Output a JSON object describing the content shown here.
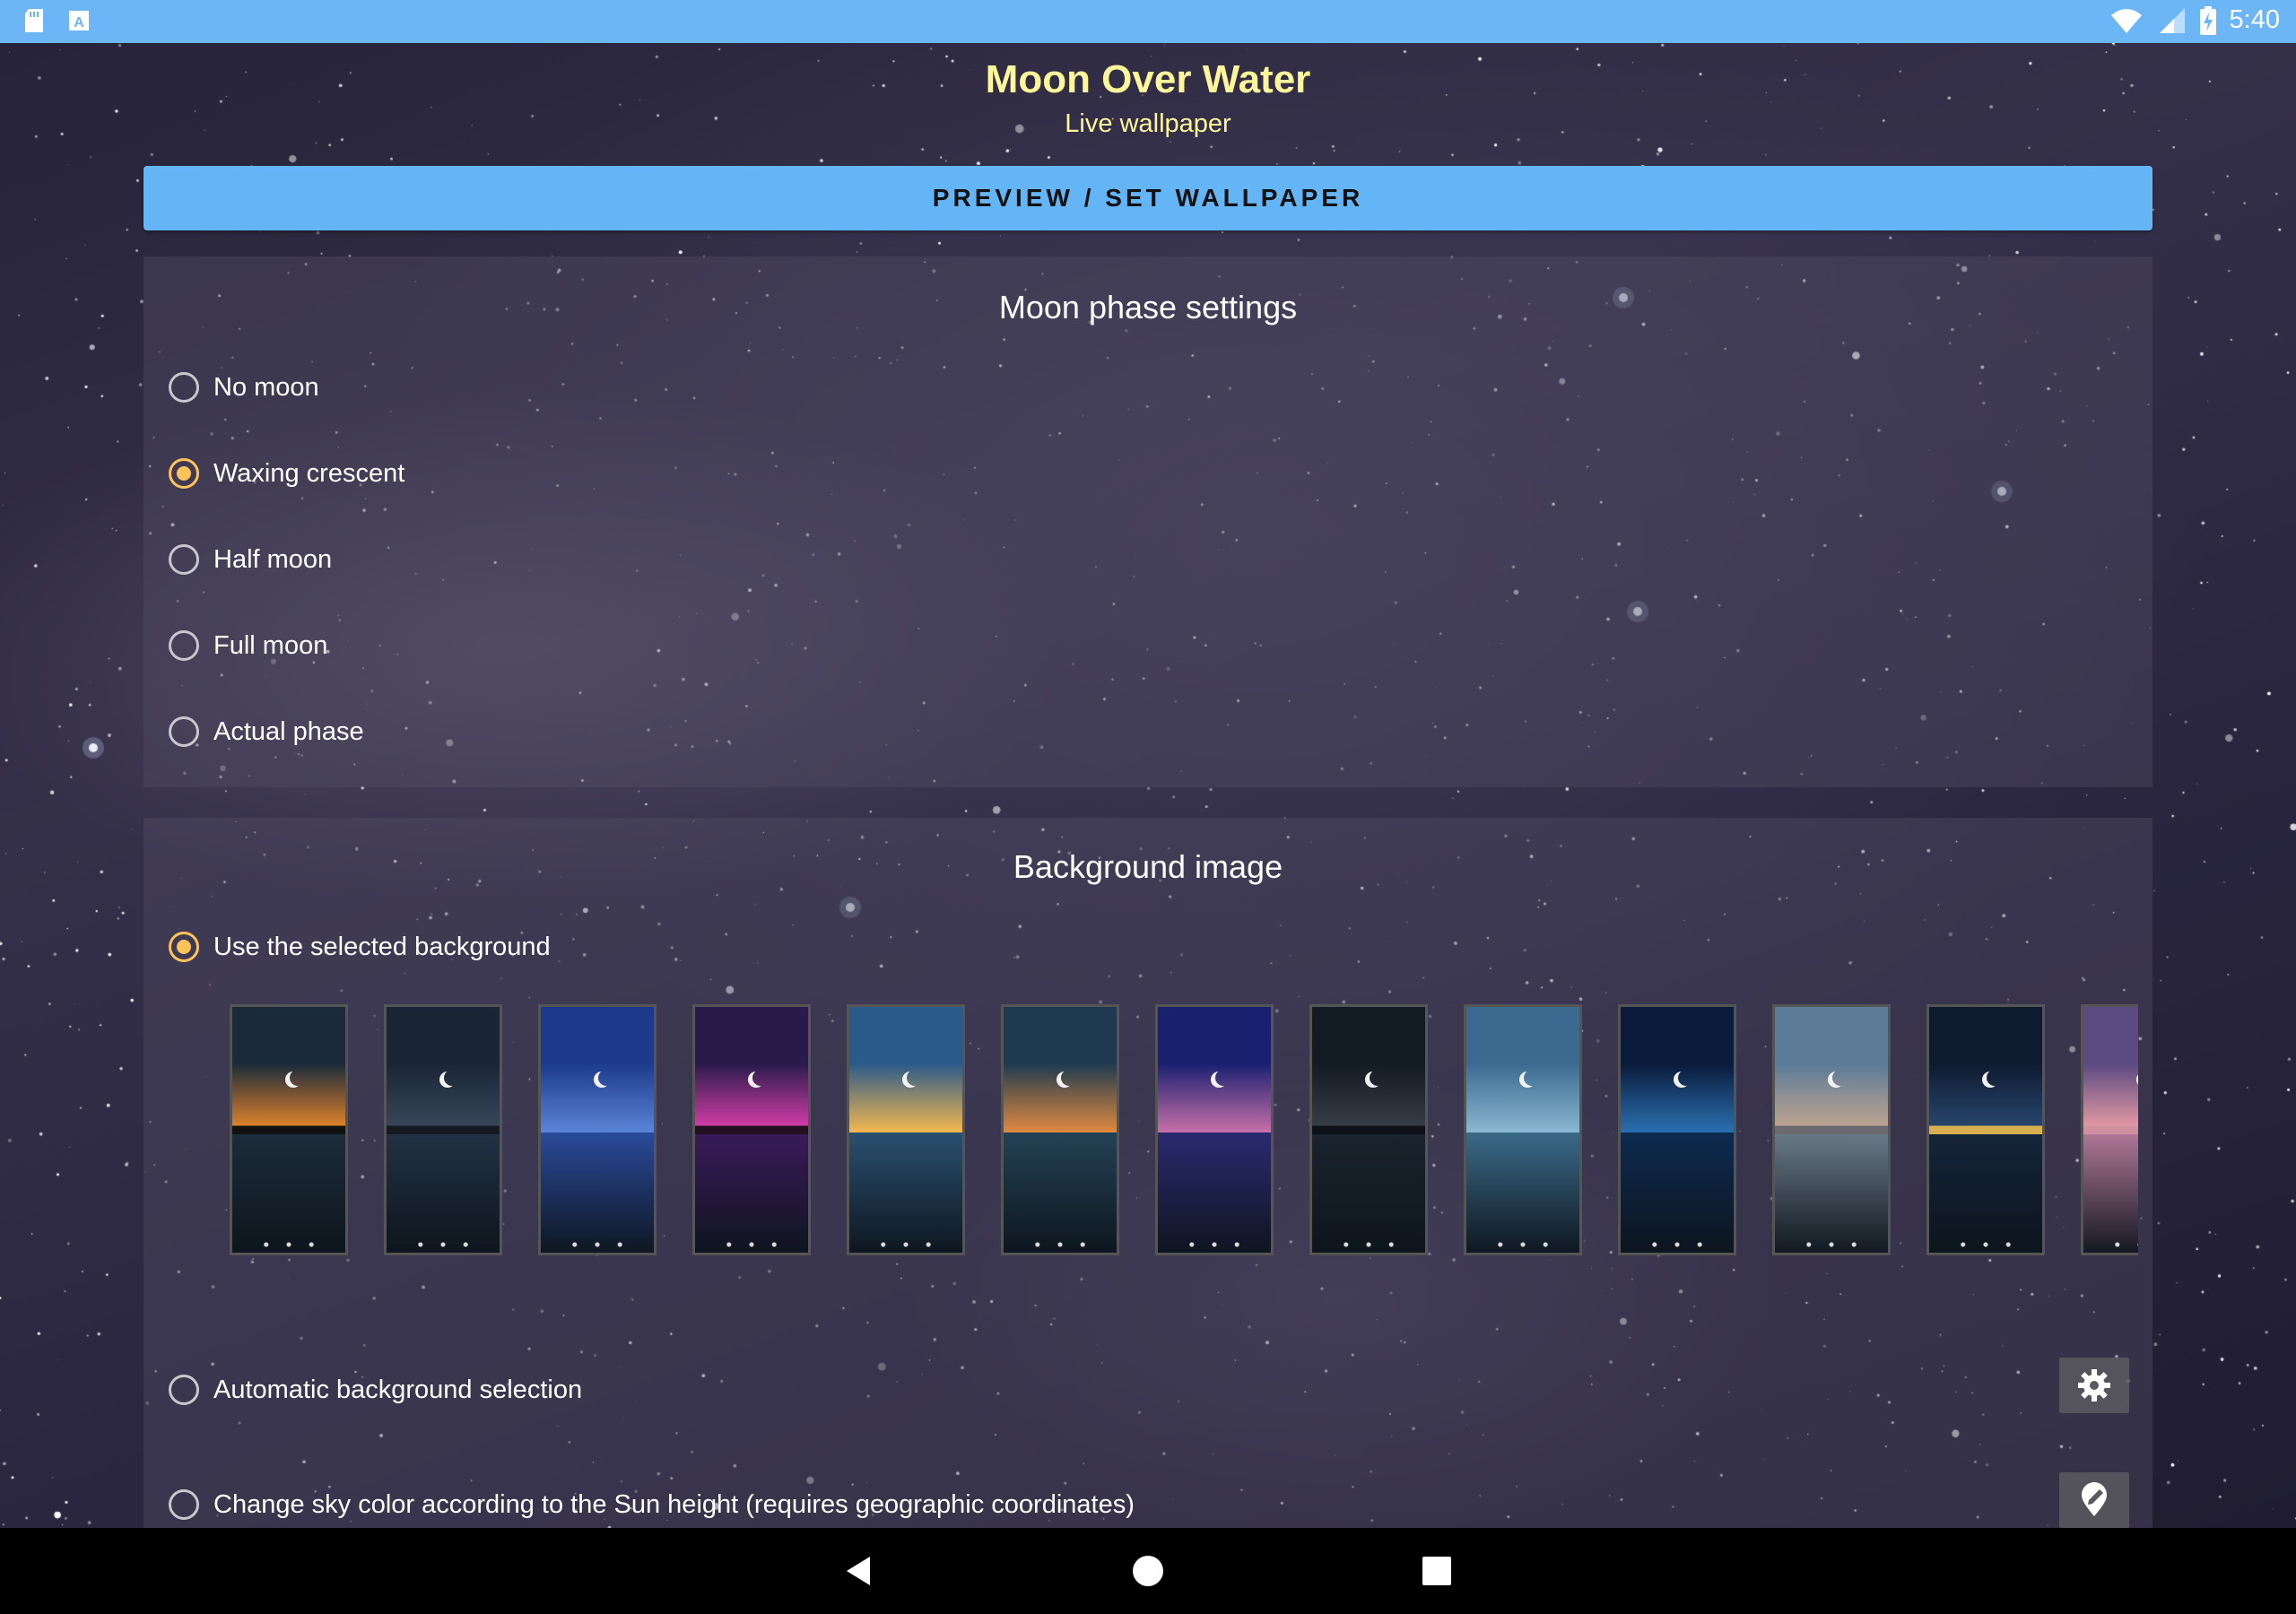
{
  "status_bar": {
    "time": "5:40",
    "left_icons": [
      "sd-card-icon",
      "text-a-icon"
    ],
    "right_icons": [
      "wifi-icon",
      "signal-icon",
      "battery-charging-icon"
    ]
  },
  "header": {
    "title": "Moon Over Water",
    "subtitle": "Live wallpaper"
  },
  "preview_button": {
    "label": "PREVIEW / SET WALLPAPER"
  },
  "moon_phase": {
    "title": "Moon phase settings",
    "options": [
      {
        "label": "No moon",
        "selected": false
      },
      {
        "label": "Waxing crescent",
        "selected": true
      },
      {
        "label": "Half moon",
        "selected": false
      },
      {
        "label": "Full moon",
        "selected": false
      },
      {
        "label": "Actual phase",
        "selected": false
      }
    ]
  },
  "background": {
    "title": "Background image",
    "use_selected_label": "Use the selected background",
    "use_selected_on": true,
    "thumbnails": [
      {
        "name": "orange-dusk",
        "sky_top": "#1a2a3a",
        "sky_bottom": "#f08a2a",
        "sea": "#1c2c3a",
        "land": "#111"
      },
      {
        "name": "dark-islands",
        "sky_top": "#1a2536",
        "sky_bottom": "#3a4a5c",
        "sea": "#223244",
        "land": "#151a22"
      },
      {
        "name": "blue-night",
        "sky_top": "#1d3a8a",
        "sky_bottom": "#5a84d8",
        "sea": "#2a4a9a",
        "land": ""
      },
      {
        "name": "purple-magenta",
        "sky_top": "#2a1a4a",
        "sky_bottom": "#e040b0",
        "sea": "#3a1a5a",
        "land": "#201020"
      },
      {
        "name": "teal-sunset",
        "sky_top": "#2a5a8a",
        "sky_bottom": "#f5b850",
        "sea": "#2a5070",
        "land": ""
      },
      {
        "name": "teal-orange",
        "sky_top": "#1f3a50",
        "sky_bottom": "#e08a40",
        "sea": "#234255",
        "land": ""
      },
      {
        "name": "violet-dusk",
        "sky_top": "#1a2070",
        "sky_bottom": "#c870a8",
        "sea": "#2a2a70",
        "land": ""
      },
      {
        "name": "dark-coast",
        "sky_top": "#121a24",
        "sky_bottom": "#3a4048",
        "sea": "#1a242e",
        "land": "#0e1218"
      },
      {
        "name": "pale-teal",
        "sky_top": "#3a6a90",
        "sky_bottom": "#8ab8d0",
        "sea": "#3a6a88",
        "land": ""
      },
      {
        "name": "deep-blue",
        "sky_top": "#0a1a3a",
        "sky_bottom": "#2a70b0",
        "sea": "#0e2a50",
        "land": ""
      },
      {
        "name": "city-dusk",
        "sky_top": "#5a7a98",
        "sky_bottom": "#c8a890",
        "sea": "#6a7a88",
        "land": "#6a6a70"
      },
      {
        "name": "city-night",
        "sky_top": "#0e1a30",
        "sky_bottom": "#2a4a70",
        "sea": "#14243a",
        "land": "#d8b050"
      },
      {
        "name": "pink-city",
        "sky_top": "#5a4a80",
        "sky_bottom": "#f0a0a8",
        "sea": "#b07898",
        "land": "#d090a0"
      }
    ],
    "auto_label": "Automatic background selection",
    "auto_on": false,
    "sky_color_label": "Change sky color according to the Sun height (requires geographic coordinates)",
    "sky_color_on": false
  },
  "colors": {
    "accent": "#ffc35a",
    "status_bar": "#6db6f5",
    "title_yellow": "#fff59a",
    "button_blue": "#64b5f6"
  }
}
